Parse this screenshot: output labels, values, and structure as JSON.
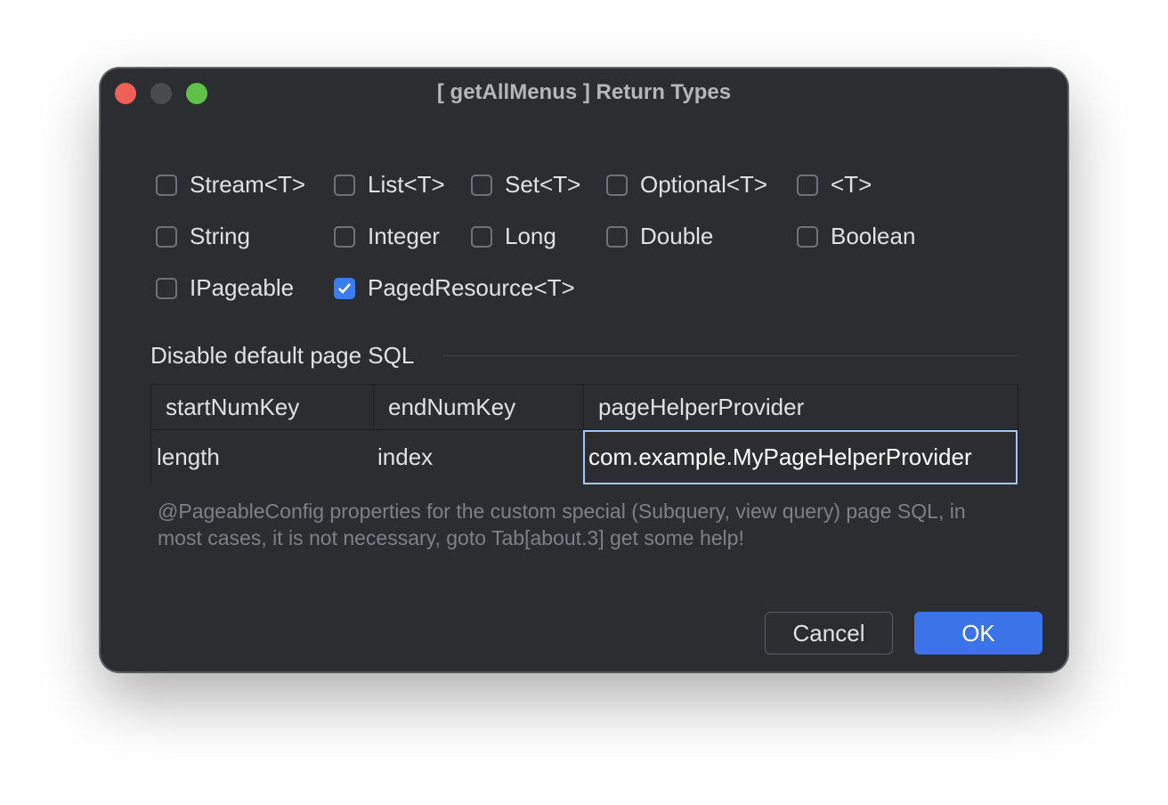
{
  "window": {
    "title": "[ getAllMenus ] Return Types"
  },
  "return_types": {
    "row1": [
      {
        "label": "Stream<T>",
        "checked": false
      },
      {
        "label": "List<T>",
        "checked": false
      },
      {
        "label": "Set<T>",
        "checked": false
      },
      {
        "label": "Optional<T>",
        "checked": false
      },
      {
        "label": "<T>",
        "checked": false
      }
    ],
    "row2": [
      {
        "label": "String",
        "checked": false
      },
      {
        "label": "Integer",
        "checked": false
      },
      {
        "label": "Long",
        "checked": false
      },
      {
        "label": "Double",
        "checked": false
      },
      {
        "label": "Boolean",
        "checked": false
      }
    ],
    "row3": [
      {
        "label": "IPageable",
        "checked": false
      },
      {
        "label": "PagedResource<T>",
        "checked": true
      }
    ]
  },
  "page_sql": {
    "section_label": "Disable default page SQL",
    "columns": [
      "startNumKey",
      "endNumKey",
      "pageHelperProvider"
    ],
    "row": [
      "length",
      "index",
      "com.example.MyPageHelperProvider"
    ],
    "help_text": "@PageableConfig properties for the custom special (Subquery, view query) page SQL, in most cases, it is not necessary, goto Tab[about.3] get some help!"
  },
  "buttons": {
    "cancel": "Cancel",
    "ok": "OK"
  },
  "colors": {
    "dialog_bg": "#2b2d30",
    "accent": "#3b73e8",
    "close": "#ee5f57",
    "maximize": "#5fc148"
  }
}
